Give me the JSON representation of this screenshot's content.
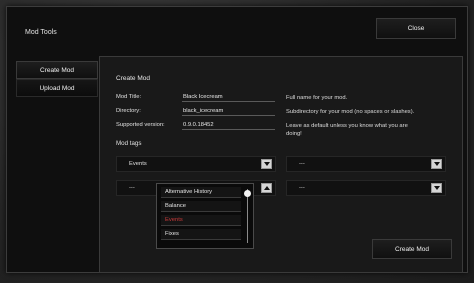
{
  "window": {
    "title": "Mod Tools",
    "close_label": "Close"
  },
  "sidebar": {
    "items": [
      {
        "label": "Create Mod"
      },
      {
        "label": "Upload Mod"
      }
    ]
  },
  "panel": {
    "title": "Create Mod",
    "fields": [
      {
        "label": "Mod Title:",
        "value": "Black Icecream",
        "hint": "Full name for your mod."
      },
      {
        "label": "Directory:",
        "value": "black_icecream",
        "hint": "Subdirectory for your mod (no spaces or slashes)."
      },
      {
        "label": "Supported version:",
        "value": "0.9.0.18452",
        "hint_line1": "Leave as default unless you know what you are",
        "hint_line2": "doing!"
      }
    ],
    "tags_label": "Mod tags",
    "tag_dropdowns": [
      {
        "value": "Events"
      },
      {
        "value": "---"
      },
      {
        "value": "---"
      },
      {
        "value": "---"
      }
    ],
    "tag_options": [
      {
        "label": "Alternative History"
      },
      {
        "label": "Balance"
      },
      {
        "label": "Events",
        "selected": true
      },
      {
        "label": "Fixes"
      }
    ],
    "create_label": "Create Mod"
  },
  "colors": {
    "selected_option": "#c93a3a",
    "background": "#0f0f0f",
    "panel": "#191919"
  },
  "icons": {
    "dropdown_arrow": "chevron-down-icon",
    "dropdown_arrow_open": "chevron-up-icon"
  }
}
